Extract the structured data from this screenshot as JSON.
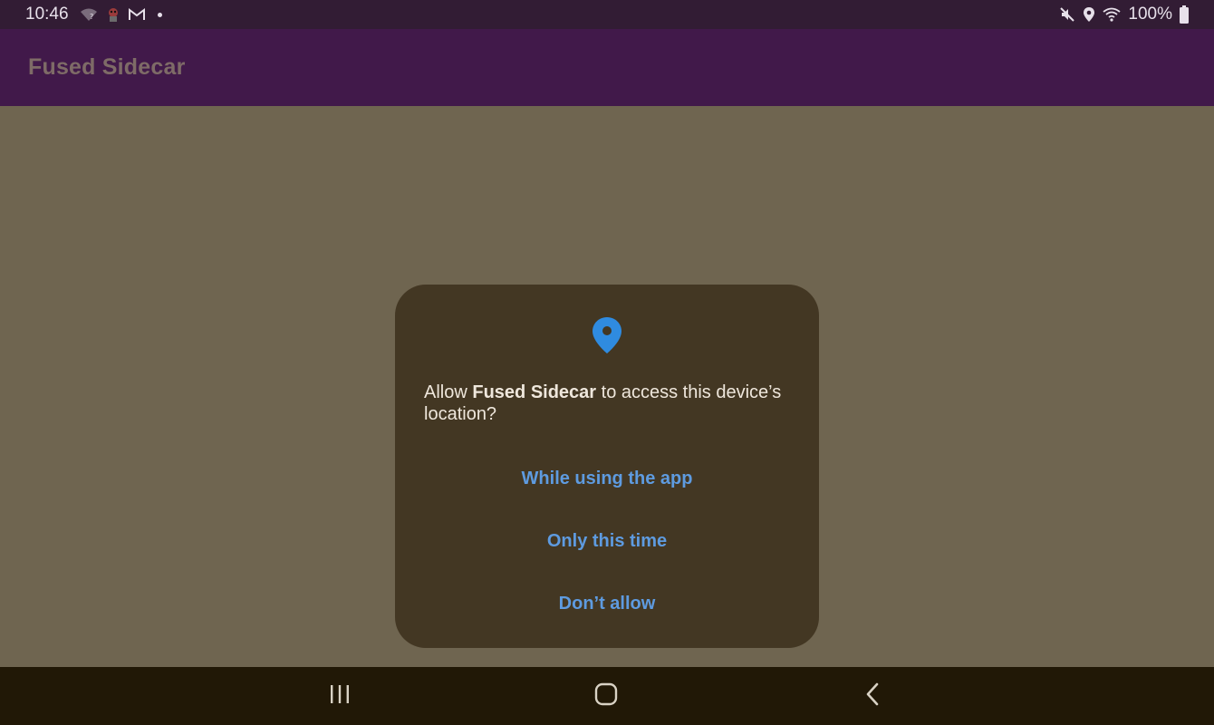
{
  "status_bar": {
    "time": "10:46",
    "battery": "100%",
    "left_icons": [
      "wifi-question-icon",
      "app-notification-icon",
      "gmail-icon",
      "more-notifications-dot"
    ],
    "right_icons": [
      "mute-icon",
      "location-icon",
      "wifi-icon",
      "battery-icon"
    ]
  },
  "app_bar": {
    "title": "Fused Sidecar"
  },
  "dialog": {
    "icon": "location-pin-icon",
    "message_prefix": "Allow ",
    "app_name": "Fused Sidecar",
    "message_suffix": " to access this device’s location?",
    "buttons": {
      "while_using": "While using the app",
      "only_this_time": "Only this time",
      "dont_allow": "Don’t allow"
    }
  },
  "nav_bar": {
    "buttons": [
      "recents-icon",
      "home-icon",
      "back-icon"
    ]
  },
  "colors": {
    "status_bar_bg": "#321c34",
    "app_bar_bg": "#41194a",
    "scrim_bg": "#6f6550",
    "dialog_bg": "#433723",
    "accent": "#5e9be0",
    "nav_bar_bg": "#211806",
    "location_pin": "#2f8be0"
  }
}
